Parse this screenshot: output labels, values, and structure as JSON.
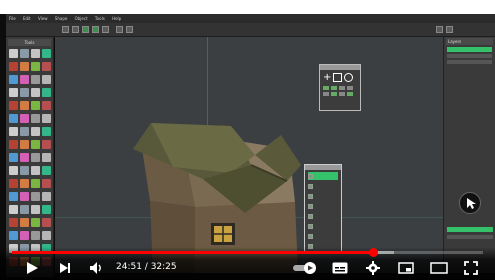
{
  "app": {
    "menu_items": [
      "File",
      "Edit",
      "View",
      "Shape",
      "Object",
      "Tools",
      "Help"
    ]
  },
  "panels": {
    "left_label": "Tools",
    "right_label": "Layers"
  },
  "selection_window": {
    "options": [
      "",
      "",
      "",
      "",
      "",
      "",
      "",
      ""
    ],
    "active_index": 0
  },
  "player": {
    "current_time": "24:51",
    "duration": "32:25",
    "time_display": "24:51 / 32:25",
    "progress_fraction": 0.767,
    "buffered_fraction": 0.81,
    "icons": {
      "play": "play-icon",
      "next": "next-icon",
      "volume": "volume-icon",
      "autoplay": "autoplay-toggle-icon",
      "subtitles": "subtitles-icon",
      "settings": "gear-icon",
      "miniplayer": "miniplayer-icon",
      "theater": "theater-mode-icon",
      "fullscreen": "fullscreen-icon"
    },
    "colors": {
      "progress": "#ff0000",
      "viewport": "#3b3f42",
      "active_option": "#35c16a"
    }
  }
}
